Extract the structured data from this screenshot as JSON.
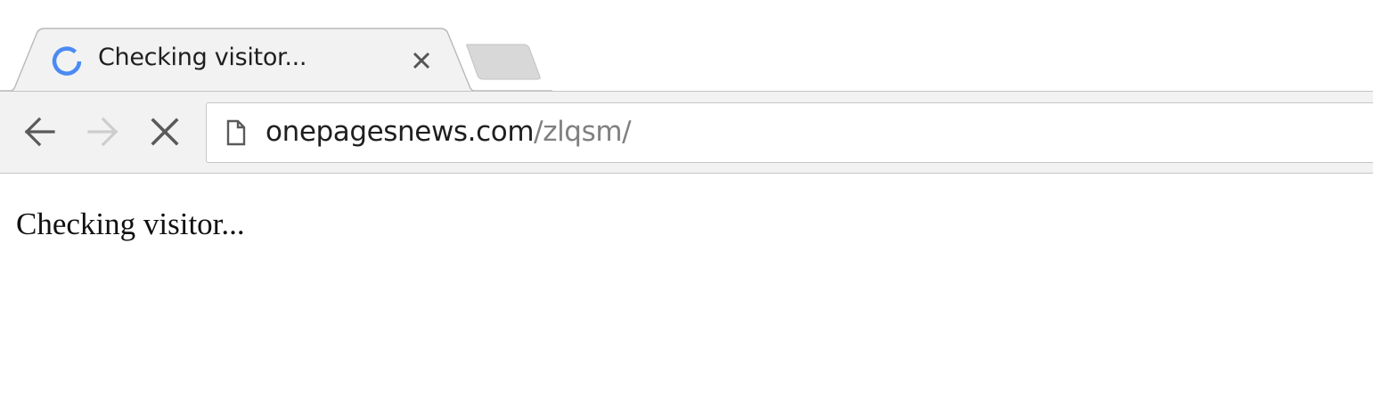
{
  "tab": {
    "title": "Checking visitor...",
    "loading_icon": "loading-spinner-icon",
    "close_icon": "close-icon"
  },
  "toolbar": {
    "back_icon": "arrow-left-icon",
    "forward_icon": "arrow-right-icon",
    "stop_icon": "close-icon"
  },
  "omnibox": {
    "page_icon": "document-icon",
    "url_host": "onepagesnews.com",
    "url_path": "/zlqsm/"
  },
  "page": {
    "text": "Checking visitor..."
  },
  "colors": {
    "spinner": "#4a8af4",
    "tab_background": "#f2f2f2",
    "toolbar_background": "#f2f2f2",
    "url_path": "#808080"
  }
}
